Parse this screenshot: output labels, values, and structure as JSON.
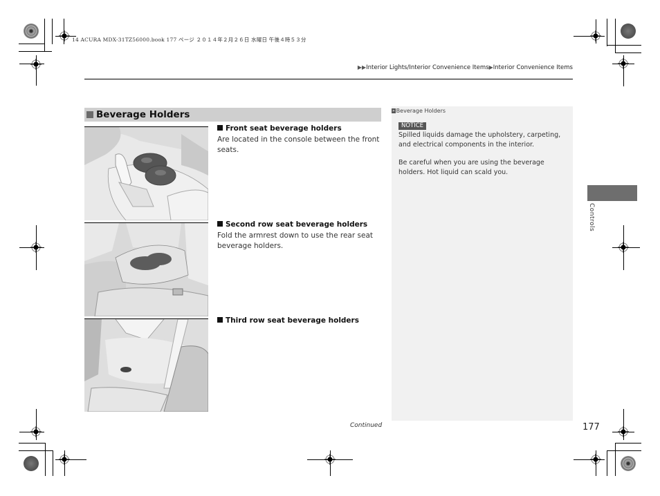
{
  "print_meta": {
    "book_info": "14 ACURA MDX-31TZ56000.book  177 ページ  ２０１４年２月２６日  水曜日  午後４時５３分"
  },
  "header": {
    "breadcrumb": [
      {
        "label": "Interior Lights/Interior Convenience Items"
      },
      {
        "label": "Interior Convenience Items"
      }
    ],
    "breadcrumb_prefix_icon": "double-triangle-right-icon",
    "breadcrumb_separator_icon": "triangle-right-icon"
  },
  "section": {
    "title": "Beverage Holders",
    "items": [
      {
        "heading": "Front seat beverage holders",
        "text": "Are located in the console between the front seats.",
        "image": "front-console-cupholder-illustration"
      },
      {
        "heading": "Second row seat beverage holders",
        "text": "Fold the armrest down to use the rear seat beverage holders.",
        "image": "second-row-armrest-cupholder-illustration"
      },
      {
        "heading": "Third row seat beverage holders",
        "text": "",
        "image": "third-row-side-cupholder-illustration"
      }
    ]
  },
  "sidebox": {
    "reference": "Beverage Holders",
    "notice_label": "NOTICE",
    "notice_text": "Spilled liquids damage the upholstery, carpeting, and electrical components in the interior.",
    "caution_text": "Be careful when you are using the beverage holders. Hot liquid can scald you."
  },
  "side_tab": {
    "label": "Controls",
    "color": "#6e6e6e"
  },
  "footer": {
    "continued": "Continued",
    "page_number": "177"
  },
  "colors": {
    "section_bar": "#cfcfcf",
    "section_square": "#6b6b6b",
    "sidebox_bg": "#f1f1f1",
    "notice_bg": "#555555"
  }
}
